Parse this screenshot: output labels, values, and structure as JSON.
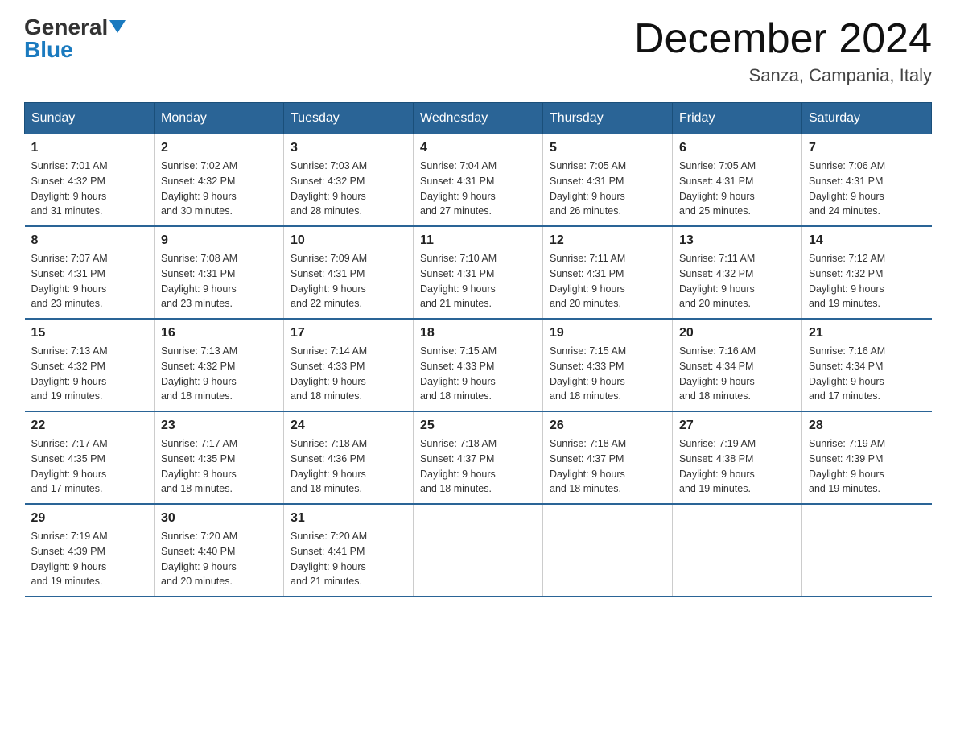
{
  "header": {
    "logo_general": "General",
    "logo_blue": "Blue",
    "month_title": "December 2024",
    "subtitle": "Sanza, Campania, Italy"
  },
  "days_of_week": [
    "Sunday",
    "Monday",
    "Tuesday",
    "Wednesday",
    "Thursday",
    "Friday",
    "Saturday"
  ],
  "weeks": [
    [
      {
        "day": "1",
        "sunrise": "7:01 AM",
        "sunset": "4:32 PM",
        "daylight": "9 hours and 31 minutes."
      },
      {
        "day": "2",
        "sunrise": "7:02 AM",
        "sunset": "4:32 PM",
        "daylight": "9 hours and 30 minutes."
      },
      {
        "day": "3",
        "sunrise": "7:03 AM",
        "sunset": "4:32 PM",
        "daylight": "9 hours and 28 minutes."
      },
      {
        "day": "4",
        "sunrise": "7:04 AM",
        "sunset": "4:31 PM",
        "daylight": "9 hours and 27 minutes."
      },
      {
        "day": "5",
        "sunrise": "7:05 AM",
        "sunset": "4:31 PM",
        "daylight": "9 hours and 26 minutes."
      },
      {
        "day": "6",
        "sunrise": "7:05 AM",
        "sunset": "4:31 PM",
        "daylight": "9 hours and 25 minutes."
      },
      {
        "day": "7",
        "sunrise": "7:06 AM",
        "sunset": "4:31 PM",
        "daylight": "9 hours and 24 minutes."
      }
    ],
    [
      {
        "day": "8",
        "sunrise": "7:07 AM",
        "sunset": "4:31 PM",
        "daylight": "9 hours and 23 minutes."
      },
      {
        "day": "9",
        "sunrise": "7:08 AM",
        "sunset": "4:31 PM",
        "daylight": "9 hours and 23 minutes."
      },
      {
        "day": "10",
        "sunrise": "7:09 AM",
        "sunset": "4:31 PM",
        "daylight": "9 hours and 22 minutes."
      },
      {
        "day": "11",
        "sunrise": "7:10 AM",
        "sunset": "4:31 PM",
        "daylight": "9 hours and 21 minutes."
      },
      {
        "day": "12",
        "sunrise": "7:11 AM",
        "sunset": "4:31 PM",
        "daylight": "9 hours and 20 minutes."
      },
      {
        "day": "13",
        "sunrise": "7:11 AM",
        "sunset": "4:32 PM",
        "daylight": "9 hours and 20 minutes."
      },
      {
        "day": "14",
        "sunrise": "7:12 AM",
        "sunset": "4:32 PM",
        "daylight": "9 hours and 19 minutes."
      }
    ],
    [
      {
        "day": "15",
        "sunrise": "7:13 AM",
        "sunset": "4:32 PM",
        "daylight": "9 hours and 19 minutes."
      },
      {
        "day": "16",
        "sunrise": "7:13 AM",
        "sunset": "4:32 PM",
        "daylight": "9 hours and 18 minutes."
      },
      {
        "day": "17",
        "sunrise": "7:14 AM",
        "sunset": "4:33 PM",
        "daylight": "9 hours and 18 minutes."
      },
      {
        "day": "18",
        "sunrise": "7:15 AM",
        "sunset": "4:33 PM",
        "daylight": "9 hours and 18 minutes."
      },
      {
        "day": "19",
        "sunrise": "7:15 AM",
        "sunset": "4:33 PM",
        "daylight": "9 hours and 18 minutes."
      },
      {
        "day": "20",
        "sunrise": "7:16 AM",
        "sunset": "4:34 PM",
        "daylight": "9 hours and 18 minutes."
      },
      {
        "day": "21",
        "sunrise": "7:16 AM",
        "sunset": "4:34 PM",
        "daylight": "9 hours and 17 minutes."
      }
    ],
    [
      {
        "day": "22",
        "sunrise": "7:17 AM",
        "sunset": "4:35 PM",
        "daylight": "9 hours and 17 minutes."
      },
      {
        "day": "23",
        "sunrise": "7:17 AM",
        "sunset": "4:35 PM",
        "daylight": "9 hours and 18 minutes."
      },
      {
        "day": "24",
        "sunrise": "7:18 AM",
        "sunset": "4:36 PM",
        "daylight": "9 hours and 18 minutes."
      },
      {
        "day": "25",
        "sunrise": "7:18 AM",
        "sunset": "4:37 PM",
        "daylight": "9 hours and 18 minutes."
      },
      {
        "day": "26",
        "sunrise": "7:18 AM",
        "sunset": "4:37 PM",
        "daylight": "9 hours and 18 minutes."
      },
      {
        "day": "27",
        "sunrise": "7:19 AM",
        "sunset": "4:38 PM",
        "daylight": "9 hours and 19 minutes."
      },
      {
        "day": "28",
        "sunrise": "7:19 AM",
        "sunset": "4:39 PM",
        "daylight": "9 hours and 19 minutes."
      }
    ],
    [
      {
        "day": "29",
        "sunrise": "7:19 AM",
        "sunset": "4:39 PM",
        "daylight": "9 hours and 19 minutes."
      },
      {
        "day": "30",
        "sunrise": "7:20 AM",
        "sunset": "4:40 PM",
        "daylight": "9 hours and 20 minutes."
      },
      {
        "day": "31",
        "sunrise": "7:20 AM",
        "sunset": "4:41 PM",
        "daylight": "9 hours and 21 minutes."
      },
      null,
      null,
      null,
      null
    ]
  ],
  "labels": {
    "sunrise": "Sunrise:",
    "sunset": "Sunset:",
    "daylight": "Daylight:"
  }
}
